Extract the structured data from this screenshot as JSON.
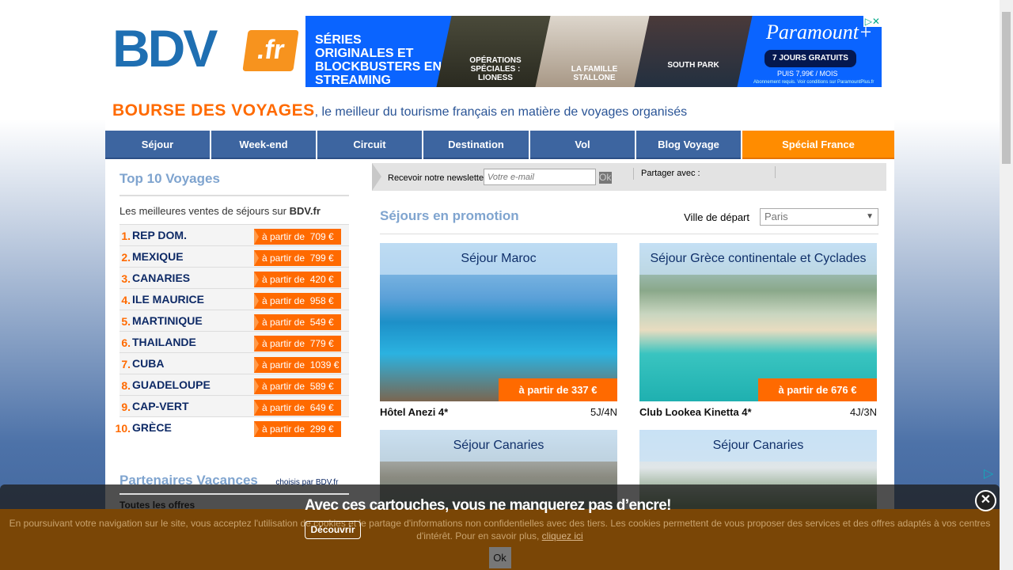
{
  "logo": {
    "text": "BDV",
    "suffix": ".fr"
  },
  "ad": {
    "headline": "SÉRIES ORIGINALES ET BLOCKBUSTERS EN STREAMING",
    "shows": [
      "OPÉRATIONS SPÉCIALES : LIONESS",
      "LA FAMILLE STALLONE",
      "SOUTH PARK"
    ],
    "brand": "Paramount+",
    "cta": "7 JOURS GRATUITS",
    "price": "PUIS 7,99€ / MOIS",
    "conditions": "Abonnement requis. Voir conditions sur ParamountPlus.fr"
  },
  "tagline": {
    "brand": "BOURSE DES VOYAGES",
    "text": ", le meilleur du tourisme français en matière de voyages organisés"
  },
  "nav": [
    "Séjour",
    "Week-end",
    "Circuit",
    "Destination",
    "Vol",
    "Blog Voyage",
    "Spécial France"
  ],
  "top10": {
    "title": "Top 10 Voyages",
    "subtitle": "Les meilleures ventes de séjours sur",
    "subtitle_brand": "BDV.fr",
    "items": [
      {
        "rank": "1.",
        "dest": "REP DOM.",
        "price": "à partir de  709 €"
      },
      {
        "rank": "2.",
        "dest": "MEXIQUE",
        "price": "à partir de  799 €"
      },
      {
        "rank": "3.",
        "dest": "CANARIES",
        "price": "à partir de  420 €"
      },
      {
        "rank": "4.",
        "dest": "ILE MAURICE",
        "price": "à partir de  958 €"
      },
      {
        "rank": "5.",
        "dest": "MARTINIQUE",
        "price": "à partir de  549 €"
      },
      {
        "rank": "6.",
        "dest": "THAILANDE",
        "price": "à partir de  779 €"
      },
      {
        "rank": "7.",
        "dest": "CUBA",
        "price": "à partir de  1039 €"
      },
      {
        "rank": "8.",
        "dest": "GUADELOUPE",
        "price": "à partir de  589 €"
      },
      {
        "rank": "9.",
        "dest": "CAP-VERT",
        "price": "à partir de  649 €"
      },
      {
        "rank": "10.",
        "dest": "GRÈCE",
        "price": "à partir de  299 €"
      }
    ]
  },
  "partners": {
    "title": "Partenaires Vacances",
    "note": "choisis par BDV.fr",
    "item": "Toutes les offres"
  },
  "newsletter": {
    "label": "Recevoir notre newsletter",
    "placeholder": "Votre e-mail",
    "ok": "Ok",
    "share": "Partager avec :"
  },
  "promo": {
    "title": "Séjours en promotion",
    "city_label": "Ville de départ",
    "city": "Paris",
    "cards": [
      {
        "caption": "Séjour Maroc",
        "price": "à partir de 337 €",
        "hotel": "Hôtel Anezi 4*",
        "duration": "5J/4N"
      },
      {
        "caption": "Séjour Grèce continentale et Cyclades",
        "price": "à partir de 676 €",
        "hotel": "Club Lookea Kinetta 4*",
        "duration": "4J/3N"
      },
      {
        "caption": "Séjour Canaries"
      },
      {
        "caption": "Séjour Canaries"
      }
    ]
  },
  "overlay_ad": {
    "title": "Avec ces cartouches, vous ne manquerez pas d’encre!",
    "button": "Découvrir"
  },
  "cookie": {
    "text": "En poursuivant votre navigation sur le site, vous acceptez l'utilisation de cookies et le partage d'informations non confidentielles avec des tiers. Les cookies permettent de vous proposer des services et des offres adaptés à vos centres d'intérêt. Pour en savoir plus, ",
    "link": "cliquez ici",
    "ok": "Ok"
  }
}
